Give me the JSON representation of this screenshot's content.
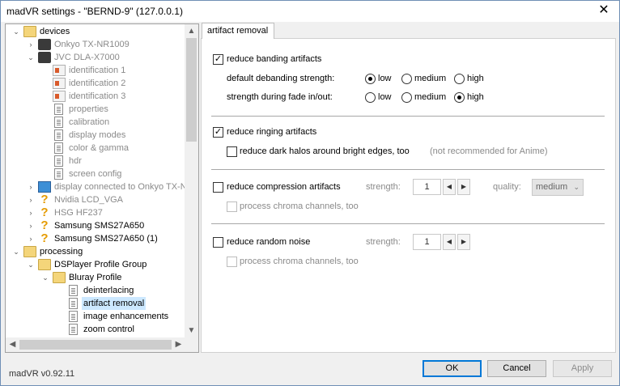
{
  "window": {
    "title": "madVR settings - \"BERND-9\" (127.0.0.1)",
    "close_glyph": "✕"
  },
  "tree": {
    "items": [
      {
        "label": "devices",
        "icon": "folder-open-icon",
        "expander": "expanded",
        "grey": false
      },
      {
        "label": "Onkyo TX-NR1009",
        "icon": "receiver-device-icon",
        "expander": "collapsed",
        "grey": true
      },
      {
        "label": "JVC DLA-X7000",
        "icon": "projector-device-icon",
        "expander": "expanded",
        "grey": true
      },
      {
        "label": "identification 1",
        "icon": "identification-icon",
        "expander": "",
        "grey": true
      },
      {
        "label": "identification 2",
        "icon": "identification-icon",
        "expander": "",
        "grey": true
      },
      {
        "label": "identification 3",
        "icon": "identification-icon",
        "expander": "",
        "grey": true
      },
      {
        "label": "properties",
        "icon": "document-icon",
        "expander": "",
        "grey": true
      },
      {
        "label": "calibration",
        "icon": "document-icon",
        "expander": "",
        "grey": true
      },
      {
        "label": "display modes",
        "icon": "document-icon",
        "expander": "",
        "grey": true
      },
      {
        "label": "color & gamma",
        "icon": "document-icon",
        "expander": "",
        "grey": true
      },
      {
        "label": "hdr",
        "icon": "document-icon",
        "expander": "",
        "grey": true
      },
      {
        "label": "screen config",
        "icon": "document-icon",
        "expander": "",
        "grey": true
      },
      {
        "label": "display connected to Onkyo TX-N",
        "icon": "monitor-icon",
        "expander": "collapsed",
        "grey": true
      },
      {
        "label": "Nvidia LCD_VGA",
        "icon": "question-icon",
        "expander": "collapsed",
        "grey": true
      },
      {
        "label": "HSG HF237",
        "icon": "question-icon",
        "expander": "collapsed",
        "grey": true
      },
      {
        "label": "Samsung SMS27A650",
        "icon": "question-icon",
        "expander": "collapsed",
        "grey": false
      },
      {
        "label": "Samsung SMS27A650 (1)",
        "icon": "question-icon",
        "expander": "collapsed",
        "grey": false
      },
      {
        "label": "processing",
        "icon": "folder-open-icon",
        "expander": "expanded",
        "grey": false
      },
      {
        "label": "DSPlayer Profile Group",
        "icon": "folder-open-icon",
        "expander": "expanded",
        "grey": false
      },
      {
        "label": "Bluray Profile",
        "icon": "folder-open-icon",
        "expander": "expanded",
        "grey": false
      },
      {
        "label": "deinterlacing",
        "icon": "document-icon",
        "expander": "",
        "grey": false
      },
      {
        "label": "artifact removal",
        "icon": "document-icon",
        "expander": "",
        "grey": false,
        "selected": true
      },
      {
        "label": "image enhancements",
        "icon": "document-icon",
        "expander": "",
        "grey": false
      },
      {
        "label": "zoom control",
        "icon": "document-icon",
        "expander": "",
        "grey": false
      }
    ]
  },
  "tab": {
    "label": "artifact removal"
  },
  "banding": {
    "checkbox_label": "reduce banding artifacts",
    "checked": true,
    "default_strength_label": "default debanding strength:",
    "fade_strength_label": "strength during fade in/out:",
    "options": [
      "low",
      "medium",
      "high"
    ],
    "default_selected": "low",
    "fade_selected": "high"
  },
  "ringing": {
    "checkbox_label": "reduce ringing artifacts",
    "checked": true,
    "halos_label": "reduce dark halos around bright edges, too",
    "halos_checked": false,
    "halos_note": "(not recommended for Anime)"
  },
  "compression": {
    "checkbox_label": "reduce compression artifacts",
    "checked": false,
    "strength_label": "strength:",
    "strength_value": "1",
    "quality_label": "quality:",
    "quality_value": "medium",
    "chroma_label": "process chroma channels, too"
  },
  "noise": {
    "checkbox_label": "reduce random noise",
    "checked": false,
    "strength_label": "strength:",
    "strength_value": "1",
    "chroma_label": "process chroma channels, too"
  },
  "footer": {
    "version": "madVR v0.92.11",
    "ok_label": "OK",
    "cancel_label": "Cancel",
    "apply_label": "Apply"
  }
}
